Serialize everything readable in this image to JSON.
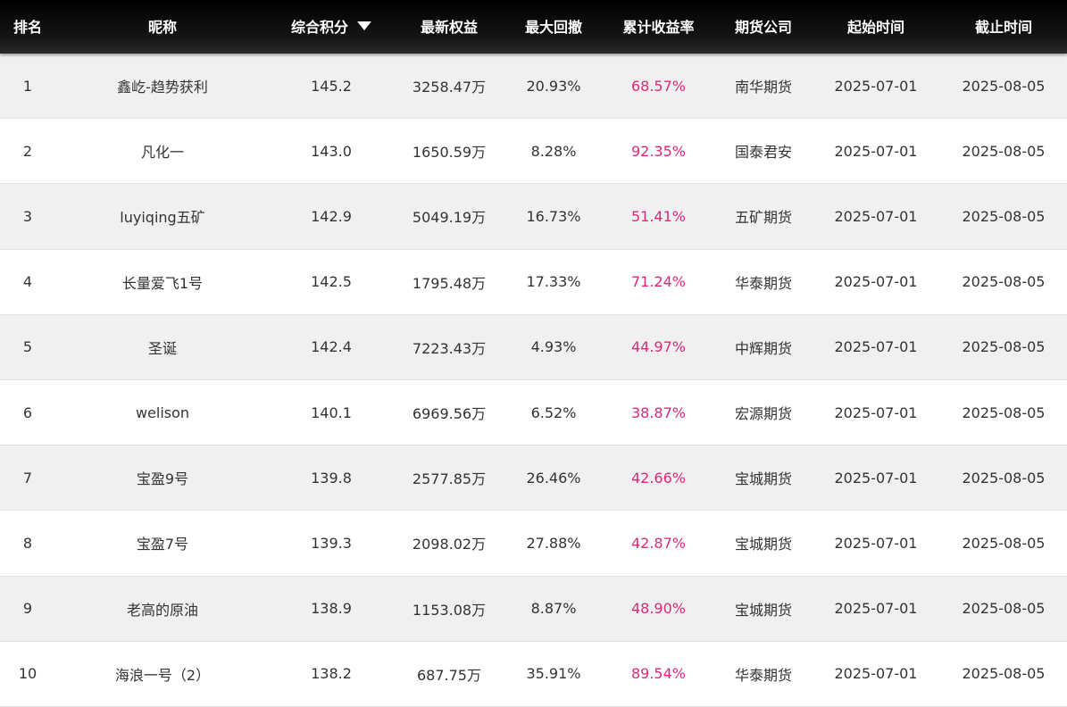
{
  "header": {
    "rank": "排名",
    "nickname": "昵称",
    "score": "综合积分",
    "equity": "最新权益",
    "drawdown": "最大回撤",
    "return": "累计收益率",
    "company": "期货公司",
    "start": "起始时间",
    "end": "截止时间"
  },
  "icons": {
    "sort": "sort-descending-icon"
  },
  "colors": {
    "header_bg": "#0b0b0b",
    "return_text": "#e0287a",
    "row_alt": "#f0f0f0"
  },
  "rows": [
    {
      "rank": "1",
      "nickname": "鑫屹-趋势获利",
      "score": "145.2",
      "equity": "3258.47万",
      "drawdown": "20.93%",
      "return": "68.57%",
      "company": "南华期货",
      "start": "2025-07-01",
      "end": "2025-08-05"
    },
    {
      "rank": "2",
      "nickname": "凡化一",
      "score": "143.0",
      "equity": "1650.59万",
      "drawdown": "8.28%",
      "return": "92.35%",
      "company": "国泰君安",
      "start": "2025-07-01",
      "end": "2025-08-05"
    },
    {
      "rank": "3",
      "nickname": "luyiqing五矿",
      "score": "142.9",
      "equity": "5049.19万",
      "drawdown": "16.73%",
      "return": "51.41%",
      "company": "五矿期货",
      "start": "2025-07-01",
      "end": "2025-08-05"
    },
    {
      "rank": "4",
      "nickname": "长量爱飞1号",
      "score": "142.5",
      "equity": "1795.48万",
      "drawdown": "17.33%",
      "return": "71.24%",
      "company": "华泰期货",
      "start": "2025-07-01",
      "end": "2025-08-05"
    },
    {
      "rank": "5",
      "nickname": "圣诞",
      "score": "142.4",
      "equity": "7223.43万",
      "drawdown": "4.93%",
      "return": "44.97%",
      "company": "中辉期货",
      "start": "2025-07-01",
      "end": "2025-08-05"
    },
    {
      "rank": "6",
      "nickname": "welison",
      "score": "140.1",
      "equity": "6969.56万",
      "drawdown": "6.52%",
      "return": "38.87%",
      "company": "宏源期货",
      "start": "2025-07-01",
      "end": "2025-08-05"
    },
    {
      "rank": "7",
      "nickname": "宝盈9号",
      "score": "139.8",
      "equity": "2577.85万",
      "drawdown": "26.46%",
      "return": "42.66%",
      "company": "宝城期货",
      "start": "2025-07-01",
      "end": "2025-08-05"
    },
    {
      "rank": "8",
      "nickname": "宝盈7号",
      "score": "139.3",
      "equity": "2098.02万",
      "drawdown": "27.88%",
      "return": "42.87%",
      "company": "宝城期货",
      "start": "2025-07-01",
      "end": "2025-08-05"
    },
    {
      "rank": "9",
      "nickname": "老高的原油",
      "score": "138.9",
      "equity": "1153.08万",
      "drawdown": "8.87%",
      "return": "48.90%",
      "company": "宝城期货",
      "start": "2025-07-01",
      "end": "2025-08-05"
    },
    {
      "rank": "10",
      "nickname": "海浪一号（2）",
      "score": "138.2",
      "equity": "687.75万",
      "drawdown": "35.91%",
      "return": "89.54%",
      "company": "华泰期货",
      "start": "2025-07-01",
      "end": "2025-08-05"
    }
  ]
}
